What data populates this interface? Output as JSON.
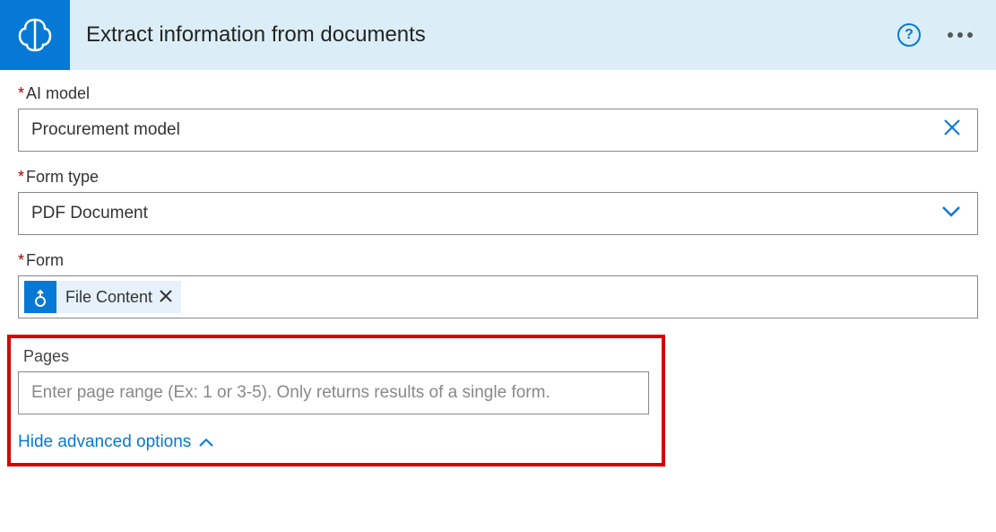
{
  "header": {
    "title": "Extract information from documents"
  },
  "fields": {
    "ai_model": {
      "label": "AI model",
      "value": "Procurement model"
    },
    "form_type": {
      "label": "Form type",
      "value": "PDF Document"
    },
    "form": {
      "label": "Form",
      "token_label": "File Content"
    },
    "pages": {
      "label": "Pages",
      "placeholder": "Enter page range (Ex: 1 or 3-5). Only returns results of a single form."
    }
  },
  "advanced_link": "Hide advanced options"
}
